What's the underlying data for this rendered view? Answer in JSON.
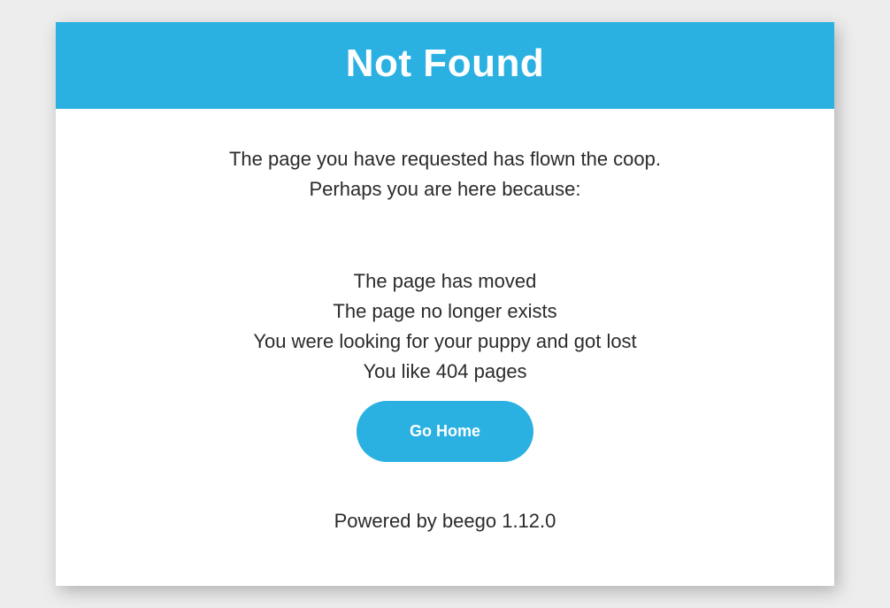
{
  "header": {
    "title": "Not Found"
  },
  "intro": {
    "line1": "The page you have requested has flown the coop.",
    "line2": "Perhaps you are here because:"
  },
  "reasons": [
    "The page has moved",
    "The page no longer exists",
    "You were looking for your puppy and got lost",
    "You like 404 pages"
  ],
  "button": {
    "label": "Go Home"
  },
  "footer": {
    "text": "Powered by beego 1.12.0"
  }
}
